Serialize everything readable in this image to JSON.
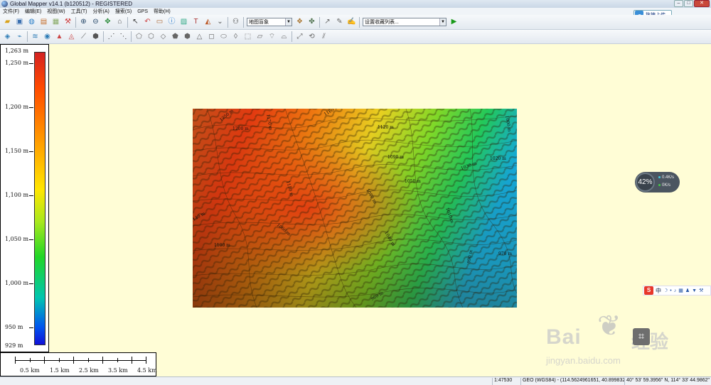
{
  "window": {
    "title": "Global Mapper v14.1 (b120512) - REGISTERED",
    "controls": {
      "minimize": "–",
      "maximize": "□",
      "close": "✕"
    }
  },
  "menus": [
    "文件(F)",
    "编辑(E)",
    "视图(W)",
    "工具(T)",
    "分析(A)",
    "搜索(S)",
    "GPS",
    "帮助(H)"
  ],
  "toolbar1": {
    "icons": [
      "open-icon",
      "save-icon",
      "globe-icon",
      "layers-icon",
      "grid-icon",
      "config-icon",
      "zoom-in-icon",
      "zoom-out-icon",
      "pan-icon",
      "home-icon",
      "select-icon",
      "undo-icon",
      "measure-icon",
      "info-icon",
      "image-icon",
      "text-icon",
      "profile-icon",
      "view-icon",
      "binoculars-icon"
    ],
    "map_theme_select": "地图盲象",
    "layers_icons": [
      "layer-control-icon",
      "overlay-icon"
    ],
    "edit_icons": [
      "digitizer-icon",
      "edit-icon",
      "attribute-icon"
    ],
    "favorites_select": "设置收藏列表...",
    "run_icon": "play-icon"
  },
  "toolbar2": {
    "icons": [
      "feature-icon-1",
      "feature-icon-2",
      "feature-icon-3",
      "feature-icon-4",
      "feature-icon-5",
      "feature-icon-6",
      "feature-icon-7",
      "feature-icon-8",
      "feature-icon-9",
      "feature-icon-10",
      "feature-icon-11",
      "feature-icon-12",
      "feature-icon-13",
      "feature-icon-14",
      "feature-icon-15",
      "feature-icon-16",
      "feature-icon-17",
      "feature-icon-18",
      "feature-icon-19",
      "feature-icon-20",
      "feature-icon-21",
      "feature-icon-22",
      "feature-icon-23",
      "feature-icon-24",
      "feature-icon-25",
      "feature-icon-26",
      "feature-icon-27"
    ]
  },
  "upload_button": {
    "label": "拖拽上传"
  },
  "elevation_legend": {
    "labels": [
      "1,263 m",
      "1,250 m",
      "1,200 m",
      "1,150 m",
      "1,100 m",
      "1,050 m",
      "1,000 m",
      "950 m",
      "929 m"
    ],
    "values": [
      1263,
      1250,
      1200,
      1150,
      1100,
      1050,
      1000,
      950,
      929
    ]
  },
  "scale_bar": {
    "labels": [
      "0.5 km",
      "1.5 km",
      "2.5 km",
      "3.5 km",
      "4.5 km"
    ]
  },
  "map": {
    "contour_labels": [
      "1250 m",
      "1200 m",
      "1170 m",
      "1160 m",
      "1120 m",
      "1090 m",
      "1050 m",
      "1030 m",
      "1020 m",
      "1000 m",
      "1150 m",
      "1140 m",
      "1100 m",
      "1060 m",
      "1080 m",
      "1040 m",
      "1010 m",
      "990 m",
      "970 m",
      "960 m"
    ]
  },
  "perf_widget": {
    "percent": "42%",
    "up": "0.4K/s",
    "down": "0K/s"
  },
  "ime_bar": {
    "logo": "S",
    "lang": "中"
  },
  "watermark": {
    "logo": "Bai",
    "logo2": "经验",
    "url": "jingyan.baidu.com"
  },
  "status": {
    "scale": "1:47530",
    "projection": "GEO (WGS84) - (114.5624961651, 40.8998321021 )",
    "coords": "40° 53' 59.3956\" N, 114° 33' 44.9862\" E"
  },
  "colors": {
    "background": "#fffdd6",
    "accent": "#3a8fd8"
  }
}
